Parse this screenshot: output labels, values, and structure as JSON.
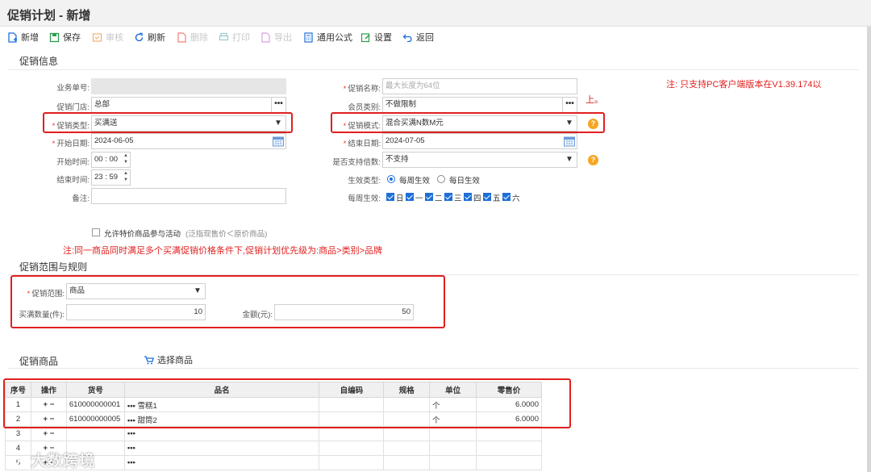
{
  "window": {
    "title": "促销计划 - 新增"
  },
  "toolbar": {
    "new": "新增",
    "save": "保存",
    "audit": "审核",
    "refresh": "刷新",
    "delete": "删除",
    "print": "打印",
    "export": "导出",
    "formula": "通用公式",
    "settings": "设置",
    "back": "返回"
  },
  "info": {
    "section_title": "促销信息",
    "order_no_label": "业务单号:",
    "order_no_value": "",
    "store_label": "促销门店:",
    "store_value": "总部",
    "type_label": "促销类型:",
    "type_value": "买满送",
    "start_date_label": "开始日期:",
    "start_date_value": "2024-06-05",
    "start_time_label": "开始时间:",
    "start_time_value": "00 : 00",
    "end_time_label": "结束时间:",
    "end_time_value": "23 : 59",
    "remark_label": "备注:",
    "remark_value": "",
    "name_label": "促销名称:",
    "name_placeholder": "最大长度为64位",
    "member_label": "会员类别:",
    "member_value": "不做限制",
    "mode_label": "促销模式:",
    "mode_value": "混合买满N数M元",
    "end_date_label": "结束日期:",
    "end_date_value": "2024-07-05",
    "multiple_label": "是否支持倍数:",
    "multiple_value": "不支持",
    "effect_type_label": "生效类型:",
    "effect_weekly": "每周生效",
    "effect_daily": "每日生效",
    "weekly_label": "每周生效:",
    "weekdays": [
      "日",
      "一",
      "二",
      "三",
      "四",
      "五",
      "六"
    ],
    "allow_special_label": "允许特价商品参与活动",
    "allow_special_hint": "(泛指现售价＜原价商品)",
    "note_right": "注: 只支持PC客户端版本在V1.39.174以",
    "note_right_2": "上。",
    "note_priority": "注:同一商品同时满足多个买满促销价格条件下,促销计划优先级为:商品>类别>品牌"
  },
  "scope": {
    "section_title": "促销范围与规则",
    "range_label": "促销范围:",
    "range_value": "商品",
    "qty_label": "买满数量(件):",
    "qty_value": "10",
    "amount_label": "金额(元):",
    "amount_value": "50"
  },
  "goods": {
    "section_title": "促销商品",
    "select_label": "选择商品",
    "headers": [
      "序号",
      "操作",
      "货号",
      "品名",
      "自编码",
      "规格",
      "单位",
      "零售价"
    ],
    "rows": [
      {
        "idx": "1",
        "code": "610000000001",
        "name": "雪糕1",
        "self_code": "",
        "spec": "",
        "unit": "个",
        "price": "6.0000"
      },
      {
        "idx": "2",
        "code": "610000000005",
        "name": "甜筒2",
        "self_code": "",
        "spec": "",
        "unit": "个",
        "price": "6.0000"
      },
      {
        "idx": "3",
        "code": "",
        "name": "",
        "self_code": "",
        "spec": "",
        "unit": "",
        "price": ""
      },
      {
        "idx": "4",
        "code": "",
        "name": "",
        "self_code": "",
        "spec": "",
        "unit": "",
        "price": ""
      },
      {
        "idx": "5",
        "code": "",
        "name": "",
        "self_code": "",
        "spec": "",
        "unit": "",
        "price": ""
      }
    ],
    "op_plus": "+",
    "op_minus": "−",
    "dots": "•••"
  },
  "watermark": {
    "text": "大数跨境"
  },
  "colors": {
    "accent": "#1e6fd9",
    "highlight": "#e02020",
    "help": "#f5a623"
  }
}
